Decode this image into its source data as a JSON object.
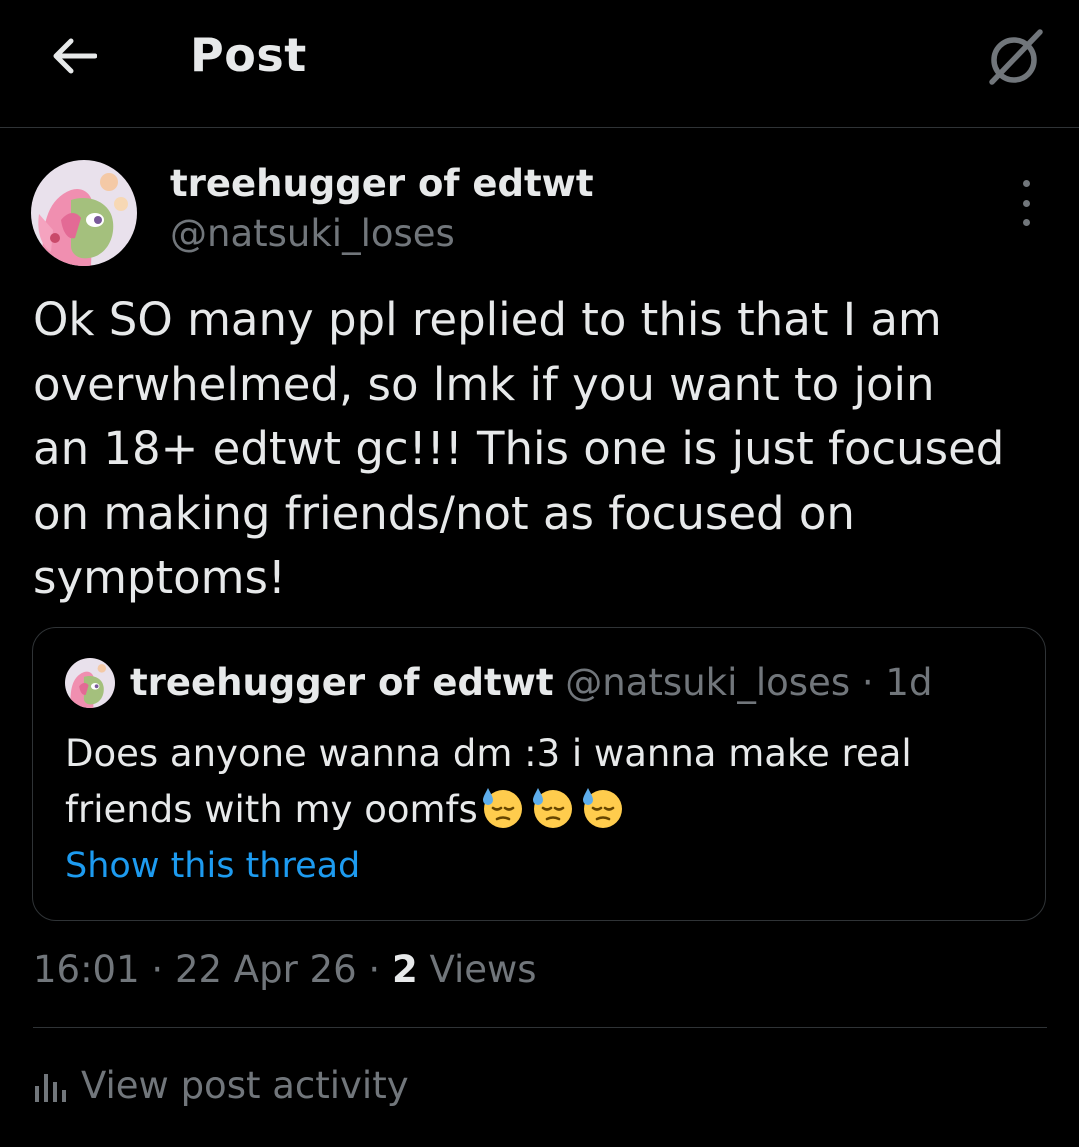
{
  "header": {
    "title": "Post",
    "back_icon": "arrow-left-icon",
    "grok_icon": "grok-slash-icon"
  },
  "post": {
    "author_name": "treehugger of edtwt",
    "author_handle": "@natsuki_loses",
    "text": "Ok SO many ppl replied to this that I am\noverwhelmed, so lmk if you want to join\nan 18+ edtwt gc!!! This one is just focused\non making friends/not as focused on\nsymptoms!",
    "time": "16:01",
    "date": "22 Apr 26",
    "views_count": "2",
    "views_label": "Views",
    "separator": "·"
  },
  "quote": {
    "author_name": "treehugger of edtwt",
    "author_handle": "@natsuki_loses",
    "age": "1d",
    "text": "Does anyone wanna dm :3 i wanna make real friends with my oomfs",
    "emoji": [
      "😓",
      "😓",
      "😓"
    ],
    "link": "Show this thread"
  },
  "activity": {
    "label": "View post activity",
    "icon": "bar-chart-icon"
  },
  "colors": {
    "background": "#000000",
    "text_primary": "#e7e9ea",
    "text_secondary": "#71767b",
    "link": "#1d9bf0",
    "border": "#2f3336"
  }
}
